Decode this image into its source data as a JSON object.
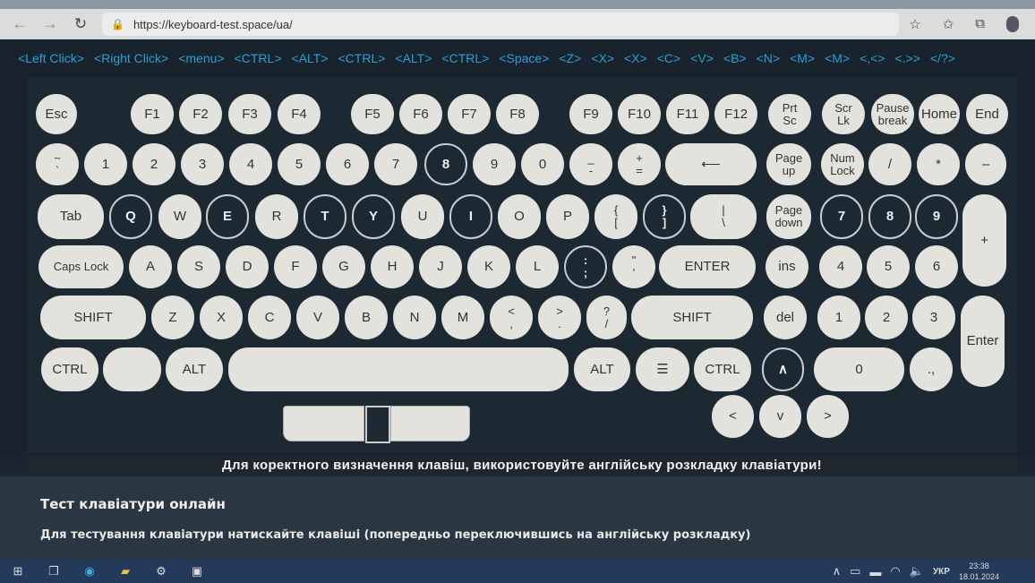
{
  "browser": {
    "url": "https://keyboard-test.space/ua/",
    "icons": [
      "back-icon",
      "forward-icon",
      "refresh-icon",
      "lock-icon",
      "favorite-add-icon",
      "favorites-icon",
      "collections-icon",
      "profile-icon"
    ]
  },
  "events": [
    "<Left Click>",
    "<Right Click>",
    "<menu>",
    "<CTRL>",
    "<ALT>",
    "<CTRL>",
    "<ALT>",
    "<CTRL>",
    "<Space>",
    "<Z>",
    "<X>",
    "<X>",
    "<C>",
    "<V>",
    "<B>",
    "<N>",
    "<M>",
    "<M>",
    "<,<>",
    "<.>>",
    "</?>"
  ],
  "keys": [
    {
      "l": "Esc"
    },
    {
      "l": "F1"
    },
    {
      "l": "F2"
    },
    {
      "l": "F3"
    },
    {
      "l": "F4"
    },
    {
      "l": "F5"
    },
    {
      "l": "F6"
    },
    {
      "l": "F7"
    },
    {
      "l": "F8"
    },
    {
      "l": "F9"
    },
    {
      "l": "F10"
    },
    {
      "l": "F11"
    },
    {
      "l": "F12"
    },
    {
      "l": "Prt\nSc"
    },
    {
      "l": "Scr\nLk"
    },
    {
      "l": "Pause\nbreak"
    },
    {
      "l": "Home"
    },
    {
      "l": "End"
    },
    {
      "l": "~\n`"
    },
    {
      "l": "1"
    },
    {
      "l": "2"
    },
    {
      "l": "3"
    },
    {
      "l": "4"
    },
    {
      "l": "5"
    },
    {
      "l": "6"
    },
    {
      "l": "7"
    },
    {
      "l": "8",
      "p": true
    },
    {
      "l": "9"
    },
    {
      "l": "0"
    },
    {
      "l": "_\n-"
    },
    {
      "l": "+\n="
    },
    {
      "l": "⟵"
    },
    {
      "l": "Page\nup"
    },
    {
      "l": "Num\nLock"
    },
    {
      "l": "/"
    },
    {
      "l": "*"
    },
    {
      "l": "–"
    },
    {
      "l": "Tab"
    },
    {
      "l": "Q",
      "p": true
    },
    {
      "l": "W"
    },
    {
      "l": "E",
      "p": true
    },
    {
      "l": "R"
    },
    {
      "l": "T",
      "p": true
    },
    {
      "l": "Y",
      "p": true
    },
    {
      "l": "U"
    },
    {
      "l": "I",
      "p": true
    },
    {
      "l": "O"
    },
    {
      "l": "P"
    },
    {
      "l": "{\n["
    },
    {
      "l": "}\n]",
      "p": true
    },
    {
      "l": "|\n\\"
    },
    {
      "l": "Page\ndown"
    },
    {
      "l": "7",
      "p": true
    },
    {
      "l": "8",
      "p": true
    },
    {
      "l": "9",
      "p": true
    },
    {
      "l": "+"
    },
    {
      "l": "Caps Lock"
    },
    {
      "l": "A"
    },
    {
      "l": "S"
    },
    {
      "l": "D"
    },
    {
      "l": "F"
    },
    {
      "l": "G"
    },
    {
      "l": "H"
    },
    {
      "l": "J"
    },
    {
      "l": "K"
    },
    {
      "l": "L"
    },
    {
      "l": ":\n;",
      "p": true
    },
    {
      "l": "\"\n'"
    },
    {
      "l": "ENTER"
    },
    {
      "l": "ins"
    },
    {
      "l": "4"
    },
    {
      "l": "5"
    },
    {
      "l": "6"
    },
    {
      "l": "SHIFT"
    },
    {
      "l": "Z"
    },
    {
      "l": "X"
    },
    {
      "l": "C"
    },
    {
      "l": "V"
    },
    {
      "l": "B"
    },
    {
      "l": "N"
    },
    {
      "l": "M"
    },
    {
      "l": "<\n,"
    },
    {
      "l": ">\n."
    },
    {
      "l": "?\n/"
    },
    {
      "l": "SHIFT"
    },
    {
      "l": "del"
    },
    {
      "l": "1"
    },
    {
      "l": "2"
    },
    {
      "l": "3"
    },
    {
      "l": "Enter"
    },
    {
      "l": "CTRL"
    },
    {
      "l": ""
    },
    {
      "l": "ALT"
    },
    {
      "l": ""
    },
    {
      "l": "ALT"
    },
    {
      "l": "☰"
    },
    {
      "l": "CTRL"
    },
    {
      "l": "∧",
      "p": true
    },
    {
      "l": "0"
    },
    {
      "l": ".,"
    },
    {
      "l": "<"
    },
    {
      "l": "v"
    },
    {
      "l": ">"
    }
  ],
  "banner": "Для коректного визначення клавіш, використовуйте англійську розкладку клавіатури!",
  "info": {
    "title": "Тест клавіатури онлайн",
    "text": "Для тестування клавіатури натискайте клавіші (попередньо переключившись на англійську розкладку)"
  },
  "taskbar": {
    "lang": "УКР",
    "time": "23:38",
    "date": "18.01.2024"
  }
}
